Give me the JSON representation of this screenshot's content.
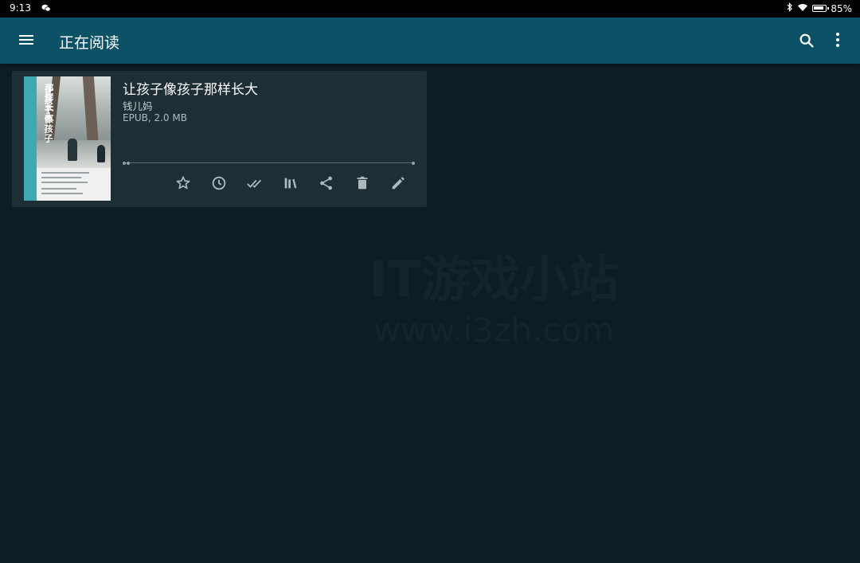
{
  "status_bar": {
    "time": "9:13",
    "battery_percent": "85%"
  },
  "app_bar": {
    "title": "正在阅读",
    "icons": [
      "menu-icon",
      "search-icon",
      "more-vert-icon"
    ]
  },
  "book": {
    "title": "让孩子像孩子那样长大",
    "author": "钱儿妈",
    "meta": "EPUB, 2.0 MB",
    "cover_title_line1": "让孩子像孩子",
    "cover_title_line2": "那样长大",
    "progress_fraction": 0.01,
    "actions": [
      "star-icon",
      "history-icon",
      "done-all-icon",
      "library-icon",
      "share-icon",
      "delete-icon",
      "edit-icon"
    ]
  },
  "watermark": {
    "line1": "IT游戏小站",
    "line2": "www.i3zh.com"
  },
  "colors": {
    "background": "#0e1d23",
    "app_bar": "#0d5166",
    "card": "#1d2e35"
  }
}
